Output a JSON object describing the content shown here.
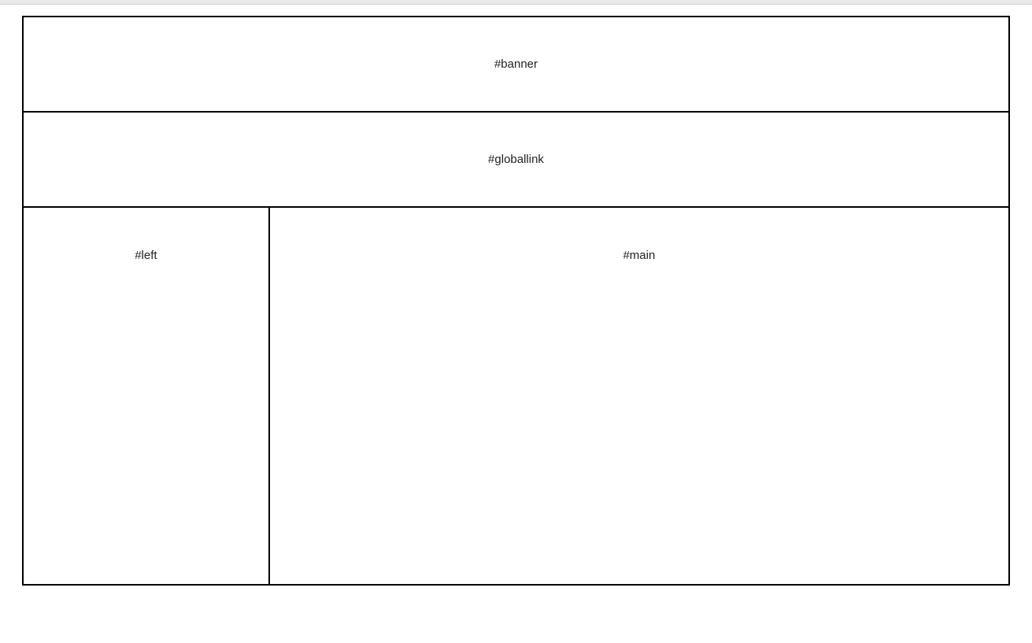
{
  "layout": {
    "banner": {
      "label": "#banner"
    },
    "globallink": {
      "label": "#globallink"
    },
    "left": {
      "label": "#left"
    },
    "main": {
      "label": "#main"
    }
  }
}
